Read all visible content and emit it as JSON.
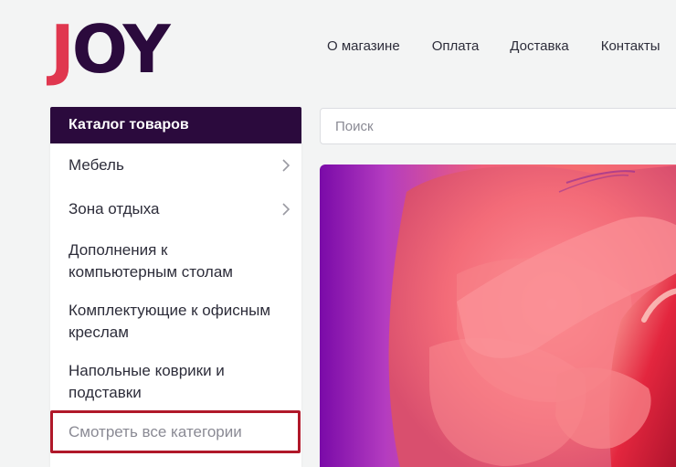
{
  "logo": {
    "letter_j": "J",
    "letters_rest": "OY"
  },
  "nav": {
    "items": [
      {
        "label": "О магазине"
      },
      {
        "label": "Оплата"
      },
      {
        "label": "Доставка"
      },
      {
        "label": "Контакты"
      }
    ]
  },
  "catalog": {
    "title": "Каталог товаров",
    "items": [
      {
        "label": "Мебель",
        "has_submenu": true
      },
      {
        "label": "Зона отдыха",
        "has_submenu": true
      },
      {
        "label": "Дополнения к компьютерным столам",
        "has_submenu": false
      },
      {
        "label": "Комплектующие к офисным креслам",
        "has_submenu": false
      },
      {
        "label": "Напольные коврики и подставки",
        "has_submenu": false
      }
    ],
    "view_all": "Смотреть все категории"
  },
  "search": {
    "placeholder": "Поиск",
    "value": ""
  },
  "colors": {
    "brand_dark": "#2b0a3d",
    "brand_red": "#e0374f",
    "highlight_border": "#b0182a"
  }
}
